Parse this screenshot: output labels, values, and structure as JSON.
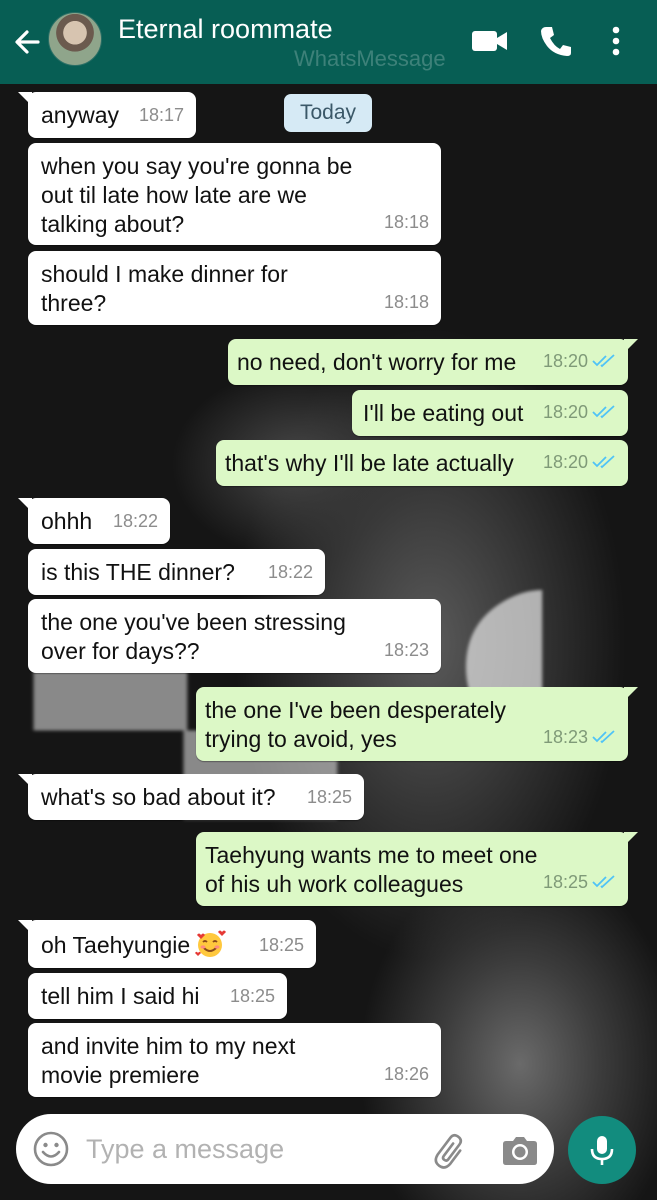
{
  "header": {
    "contact_name": "Eternal roommate",
    "watermark": "WhatsMessage",
    "accent": "#075e54"
  },
  "date_chip": "Today",
  "messages": [
    {
      "dir": "in",
      "text": "anyway",
      "time": "18:17"
    },
    {
      "dir": "in",
      "text": "when you say you're gonna be out til late how late are we talking about?",
      "time": "18:18"
    },
    {
      "dir": "in",
      "text": "should I make dinner for three?",
      "time": "18:18"
    },
    {
      "dir": "out",
      "text": "no need, don't worry for me",
      "time": "18:20",
      "status": "read"
    },
    {
      "dir": "out",
      "text": "I'll be eating out",
      "time": "18:20",
      "status": "read"
    },
    {
      "dir": "out",
      "text": "that's why I'll be late actually",
      "time": "18:20",
      "status": "read"
    },
    {
      "dir": "in",
      "text": "ohhh",
      "time": "18:22"
    },
    {
      "dir": "in",
      "text": "is this THE dinner?",
      "time": "18:22"
    },
    {
      "dir": "in",
      "text": "the one you've been stressing over for days??",
      "time": "18:23"
    },
    {
      "dir": "out",
      "text": "the one I've been desperately trying to avoid, yes",
      "time": "18:23",
      "status": "read"
    },
    {
      "dir": "in",
      "text": "what's so bad about it?",
      "time": "18:25"
    },
    {
      "dir": "out",
      "text": "Taehyung wants me to meet one of his uh work colleagues",
      "time": "18:25",
      "status": "read"
    },
    {
      "dir": "in",
      "text": "oh Taehyungie",
      "emoji": "smiling-face-with-hearts",
      "time": "18:25"
    },
    {
      "dir": "in",
      "text": "tell him I said hi",
      "time": "18:25"
    },
    {
      "dir": "in",
      "text": "and invite him to my next movie premiere",
      "time": "18:26"
    }
  ],
  "composer": {
    "placeholder": "Type a message"
  },
  "colors": {
    "incoming_bubble": "#ffffff",
    "outgoing_bubble": "#dcf8c6",
    "read_ticks": "#4fc3f7",
    "mic_button": "#128c7e"
  }
}
